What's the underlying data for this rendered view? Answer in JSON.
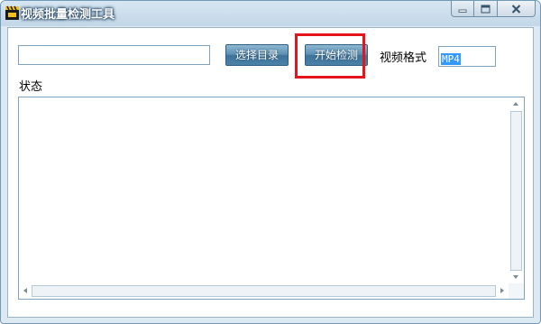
{
  "window": {
    "title": "视频批量检测工具",
    "icon": "clapperboard-icon",
    "controls": [
      "minimize-icon",
      "maximize-icon",
      "close-icon"
    ]
  },
  "toolbar": {
    "path_value": "",
    "select_dir_label": "选择目录",
    "start_label": "开始检测",
    "format_label": "视频格式",
    "format_value": "MP4"
  },
  "status": {
    "label": "状态",
    "content": ""
  },
  "colors": {
    "highlight": "#e4161b",
    "button": "#4b82a8",
    "selection": "#3399ff"
  }
}
